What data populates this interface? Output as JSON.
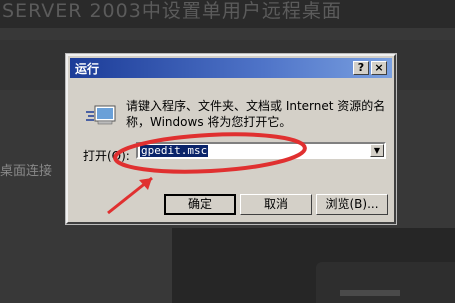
{
  "background": {
    "top_strip_text": "SERVER 2003中设置单用户远程桌面",
    "side_text": "桌面连接",
    "colors": {
      "bg": "#3a3a3a",
      "dialog": "#d4d0c8",
      "title_from": "#1c3c98",
      "annotation": "#e03030"
    }
  },
  "dialog": {
    "title": "运行",
    "help_label": "?",
    "close_label": "×",
    "description": "请键入程序、文件夹、文档或 Internet 资源的名称，Windows 将为您打开它。",
    "open_label": "打开(O):",
    "input_value": "gpedit.msc",
    "buttons": {
      "ok": "确定",
      "cancel": "取消",
      "browse": "浏览(B)..."
    },
    "icons": {
      "run": "run-dialog-icon",
      "dropdown": "chevron-down-icon"
    }
  }
}
